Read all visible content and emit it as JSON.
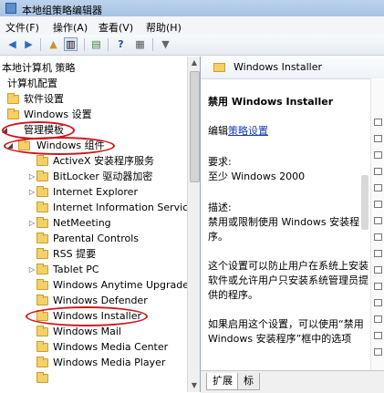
{
  "window": {
    "title": "本地组策略编辑器"
  },
  "menu": [
    "文件(F)",
    "操作(A)",
    "查看(V)",
    "帮助(H)"
  ],
  "toolbar": {
    "icons": [
      "back-icon",
      "forward-icon",
      "up-folder-icon",
      "show-hide-tree-icon",
      "export-list-icon",
      "help-icon",
      "properties-icon",
      "filter-icon"
    ]
  },
  "tree": {
    "root": "本地计算机 策略",
    "items": [
      "计算机配置",
      "软件设置",
      "Windows 设置",
      "管理模板",
      "Windows 组件",
      "ActiveX 安装程序服务",
      "BitLocker 驱动器加密",
      "Internet Explorer",
      "Internet Information Services",
      "NetMeeting",
      "Parental Controls",
      "RSS 提要",
      "Tablet PC",
      "Windows Anytime Upgrade",
      "Windows Defender",
      "Windows Installer",
      "Windows Mail",
      "Windows Media Center",
      "Windows Media Player"
    ]
  },
  "right": {
    "header": "Windows Installer",
    "heading": "禁用 Windows Installer",
    "edit_prefix": "编辑",
    "edit_link": "策略设置",
    "req_label": "要求:",
    "req_value": "至少 Windows 2000",
    "desc_label": "描述:",
    "desc_1": "禁用或限制使用 Windows 安装程序。",
    "desc_2": "这个设置可以防止用户在系统上安装软件或允许用户只安装系统管理员提供的程序。",
    "desc_3": "如果启用这个设置，可以使用“禁用 Windows 安装程序”框中的选项"
  },
  "tabs": [
    "扩展",
    "标"
  ],
  "colors": {
    "annotation": "#d0141a",
    "link": "#1a3fb0"
  }
}
